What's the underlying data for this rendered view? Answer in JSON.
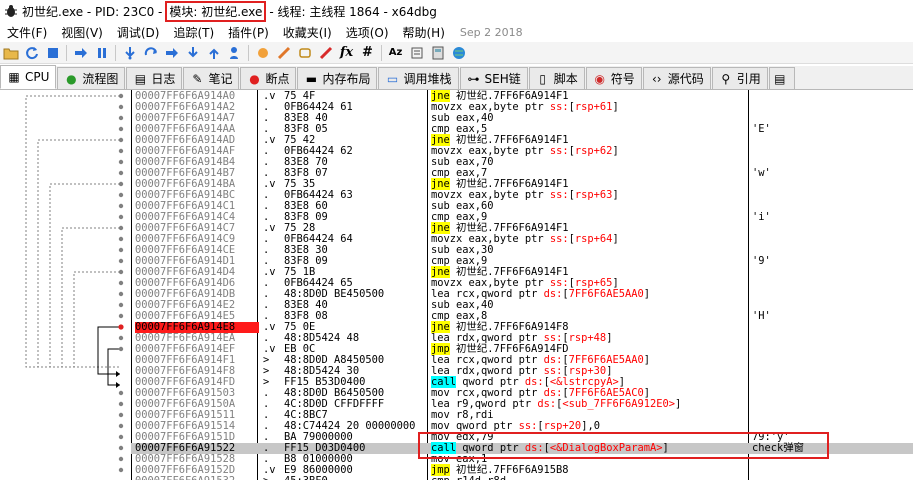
{
  "window": {
    "title_prefix": "初世纪.exe - PID: 23C0 - ",
    "title_module": "模块: 初世纪.exe",
    "title_suffix": " - 线程: 主线程 1864 - x64dbg"
  },
  "menu": {
    "items": [
      "文件(F)",
      "视图(V)",
      "调试(D)",
      "追踪(T)",
      "插件(P)",
      "收藏夹(I)",
      "选项(O)",
      "帮助(H)"
    ],
    "build_date": "Sep 2 2018"
  },
  "toolbar": {
    "icons": [
      "open-icon",
      "restart-icon",
      "stop-icon",
      "run-icon",
      "pause-icon",
      "step-into-icon",
      "step-over-icon",
      "trace-into-icon",
      "trace-over-icon",
      "execute-till-return-icon",
      "run-to-user-code-icon",
      "scylla-icon",
      "comment-icon",
      "label-icon",
      "bookmark-icon",
      "function-icon",
      "hash-icon",
      "font-icon",
      "strings-icon",
      "calculator-icon",
      "globe-icon"
    ],
    "text_glyphs": {
      "function": "fx",
      "hash": "#",
      "font": "Az"
    }
  },
  "tabs": [
    {
      "label": "CPU",
      "icon": "cpu-icon",
      "active": true
    },
    {
      "label": "流程图",
      "icon": "graph-icon"
    },
    {
      "label": "日志",
      "icon": "log-icon"
    },
    {
      "label": "笔记",
      "icon": "notes-icon"
    },
    {
      "label": "断点",
      "icon": "breakpoint-icon"
    },
    {
      "label": "内存布局",
      "icon": "memory-map-icon"
    },
    {
      "label": "调用堆栈",
      "icon": "call-stack-icon"
    },
    {
      "label": "SEH链",
      "icon": "seh-icon"
    },
    {
      "label": "脚本",
      "icon": "script-icon"
    },
    {
      "label": "符号",
      "icon": "symbols-icon"
    },
    {
      "label": "源代码",
      "icon": "source-icon"
    },
    {
      "label": "引用",
      "icon": "references-icon"
    }
  ],
  "disassembly": [
    {
      "addr": "00007FF6F6A914A0",
      "mark": ".v",
      "bytes": "75 4F",
      "asm": [
        [
          "jne",
          "jne"
        ],
        [
          "lbl",
          " 初世纪.7FF6F6A914F1"
        ]
      ],
      "comment": ""
    },
    {
      "addr": "00007FF6F6A914A2",
      "mark": ".",
      "bytes": "0FB64424 61",
      "asm": [
        [
          "kw",
          "movzx eax,byte ptr "
        ],
        [
          "seg",
          "ss:"
        ],
        [
          "brk",
          "["
        ],
        [
          "mem",
          "rsp+61"
        ],
        [
          "brk",
          "]"
        ]
      ],
      "comment": ""
    },
    {
      "addr": "00007FF6F6A914A7",
      "mark": ".",
      "bytes": "83E8 40",
      "asm": [
        [
          "kw",
          "sub eax,40"
        ]
      ],
      "comment": ""
    },
    {
      "addr": "00007FF6F6A914AA",
      "mark": ".",
      "bytes": "83F8 05",
      "asm": [
        [
          "kw",
          "cmp eax,5"
        ]
      ],
      "comment": "'E'"
    },
    {
      "addr": "00007FF6F6A914AD",
      "mark": ".v",
      "bytes": "75 42",
      "asm": [
        [
          "jne",
          "jne"
        ],
        [
          "lbl",
          " 初世纪.7FF6F6A914F1"
        ]
      ],
      "comment": ""
    },
    {
      "addr": "00007FF6F6A914AF",
      "mark": ".",
      "bytes": "0FB64424 62",
      "asm": [
        [
          "kw",
          "movzx eax,byte ptr "
        ],
        [
          "seg",
          "ss:"
        ],
        [
          "brk",
          "["
        ],
        [
          "mem",
          "rsp+62"
        ],
        [
          "brk",
          "]"
        ]
      ],
      "comment": ""
    },
    {
      "addr": "00007FF6F6A914B4",
      "mark": ".",
      "bytes": "83E8 70",
      "asm": [
        [
          "kw",
          "sub eax,70"
        ]
      ],
      "comment": ""
    },
    {
      "addr": "00007FF6F6A914B7",
      "mark": ".",
      "bytes": "83F8 07",
      "asm": [
        [
          "kw",
          "cmp eax,7"
        ]
      ],
      "comment": "'w'"
    },
    {
      "addr": "00007FF6F6A914BA",
      "mark": ".v",
      "bytes": "75 35",
      "asm": [
        [
          "jne",
          "jne"
        ],
        [
          "lbl",
          " 初世纪.7FF6F6A914F1"
        ]
      ],
      "comment": ""
    },
    {
      "addr": "00007FF6F6A914BC",
      "mark": ".",
      "bytes": "0FB64424 63",
      "asm": [
        [
          "kw",
          "movzx eax,byte ptr "
        ],
        [
          "seg",
          "ss:"
        ],
        [
          "brk",
          "["
        ],
        [
          "mem",
          "rsp+63"
        ],
        [
          "brk",
          "]"
        ]
      ],
      "comment": ""
    },
    {
      "addr": "00007FF6F6A914C1",
      "mark": ".",
      "bytes": "83E8 60",
      "asm": [
        [
          "kw",
          "sub eax,60"
        ]
      ],
      "comment": ""
    },
    {
      "addr": "00007FF6F6A914C4",
      "mark": ".",
      "bytes": "83F8 09",
      "asm": [
        [
          "kw",
          "cmp eax,9"
        ]
      ],
      "comment": "'i'"
    },
    {
      "addr": "00007FF6F6A914C7",
      "mark": ".v",
      "bytes": "75 28",
      "asm": [
        [
          "jne",
          "jne"
        ],
        [
          "lbl",
          " 初世纪.7FF6F6A914F1"
        ]
      ],
      "comment": ""
    },
    {
      "addr": "00007FF6F6A914C9",
      "mark": ".",
      "bytes": "0FB64424 64",
      "asm": [
        [
          "kw",
          "movzx eax,byte ptr "
        ],
        [
          "seg",
          "ss:"
        ],
        [
          "brk",
          "["
        ],
        [
          "mem",
          "rsp+64"
        ],
        [
          "brk",
          "]"
        ]
      ],
      "comment": ""
    },
    {
      "addr": "00007FF6F6A914CE",
      "mark": ".",
      "bytes": "83E8 30",
      "asm": [
        [
          "kw",
          "sub eax,30"
        ]
      ],
      "comment": ""
    },
    {
      "addr": "00007FF6F6A914D1",
      "mark": ".",
      "bytes": "83F8 09",
      "asm": [
        [
          "kw",
          "cmp eax,9"
        ]
      ],
      "comment": "'9'"
    },
    {
      "addr": "00007FF6F6A914D4",
      "mark": ".v",
      "bytes": "75 1B",
      "asm": [
        [
          "jne",
          "jne"
        ],
        [
          "lbl",
          " 初世纪.7FF6F6A914F1"
        ]
      ],
      "comment": ""
    },
    {
      "addr": "00007FF6F6A914D6",
      "mark": ".",
      "bytes": "0FB64424 65",
      "asm": [
        [
          "kw",
          "movzx eax,byte ptr "
        ],
        [
          "seg",
          "ss:"
        ],
        [
          "brk",
          "["
        ],
        [
          "mem",
          "rsp+65"
        ],
        [
          "brk",
          "]"
        ]
      ],
      "comment": ""
    },
    {
      "addr": "00007FF6F6A914DB",
      "mark": ".",
      "bytes": "48:8D0D BE450500",
      "asm": [
        [
          "kw",
          "lea rcx,qword ptr "
        ],
        [
          "seg",
          "ds:"
        ],
        [
          "brk",
          "["
        ],
        [
          "mem",
          "7FF6F6AE5AA0"
        ],
        [
          "brk",
          "]"
        ]
      ],
      "comment": ""
    },
    {
      "addr": "00007FF6F6A914E2",
      "mark": ".",
      "bytes": "83E8 40",
      "asm": [
        [
          "kw",
          "sub eax,40"
        ]
      ],
      "comment": ""
    },
    {
      "addr": "00007FF6F6A914E5",
      "mark": ".",
      "bytes": "83F8 08",
      "asm": [
        [
          "kw",
          "cmp eax,8"
        ]
      ],
      "comment": "'H'"
    },
    {
      "addr": "00007FF6F6A914E8",
      "mark": ".v",
      "bytes": "75 0E",
      "asm": [
        [
          "jne",
          "jne"
        ],
        [
          "lbl",
          " 初世纪.7FF6F6A914F8"
        ]
      ],
      "comment": "",
      "bp": true
    },
    {
      "addr": "00007FF6F6A914EA",
      "mark": ".",
      "bytes": "48:8D5424 48",
      "asm": [
        [
          "kw",
          "lea rdx,qword ptr "
        ],
        [
          "seg",
          "ss:"
        ],
        [
          "brk",
          "["
        ],
        [
          "mem",
          "rsp+48"
        ],
        [
          "brk",
          "]"
        ]
      ],
      "comment": ""
    },
    {
      "addr": "00007FF6F6A914EF",
      "mark": ".v",
      "bytes": "EB 0C",
      "asm": [
        [
          "jmp",
          "jmp"
        ],
        [
          "lbl",
          " 初世纪.7FF6F6A914FD"
        ]
      ],
      "comment": ""
    },
    {
      "addr": "00007FF6F6A914F1",
      "mark": ">",
      "bytes": "48:8D0D A8450500",
      "asm": [
        [
          "kw",
          "lea rcx,qword ptr "
        ],
        [
          "seg",
          "ds:"
        ],
        [
          "brk",
          "["
        ],
        [
          "mem",
          "7FF6F6AE5AA0"
        ],
        [
          "brk",
          "]"
        ]
      ],
      "comment": ""
    },
    {
      "addr": "00007FF6F6A914F8",
      "mark": ">",
      "bytes": "48:8D5424 30",
      "asm": [
        [
          "kw",
          "lea rdx,qword ptr "
        ],
        [
          "seg",
          "ss:"
        ],
        [
          "brk",
          "["
        ],
        [
          "mem",
          "rsp+30"
        ],
        [
          "brk",
          "]"
        ]
      ],
      "comment": ""
    },
    {
      "addr": "00007FF6F6A914FD",
      "mark": ">",
      "bytes": "FF15 B53D0400",
      "asm": [
        [
          "call",
          "call"
        ],
        [
          "kw",
          " qword ptr "
        ],
        [
          "seg",
          "ds:"
        ],
        [
          "brk",
          "["
        ],
        [
          "mem",
          "<&lstrcpyA>"
        ],
        [
          "brk",
          "]"
        ]
      ],
      "comment": ""
    },
    {
      "addr": "00007FF6F6A91503",
      "mark": ".",
      "bytes": "48:8D0D B6450500",
      "asm": [
        [
          "kw",
          "mov rcx,qword ptr "
        ],
        [
          "seg",
          "ds:"
        ],
        [
          "brk",
          "["
        ],
        [
          "mem",
          "7FF6F6AE5AC0"
        ],
        [
          "brk",
          "]"
        ]
      ],
      "comment": ""
    },
    {
      "addr": "00007FF6F6A9150A",
      "mark": ".",
      "bytes": "4C:8D0D CFFDFFFF",
      "asm": [
        [
          "kw",
          "lea r9,qword ptr "
        ],
        [
          "seg",
          "ds:"
        ],
        [
          "brk",
          "["
        ],
        [
          "mem",
          "<sub_7FF6F6A912E0>"
        ],
        [
          "brk",
          "]"
        ]
      ],
      "comment": ""
    },
    {
      "addr": "00007FF6F6A91511",
      "mark": ".",
      "bytes": "4C:8BC7",
      "asm": [
        [
          "kw",
          "mov r8,rdi"
        ]
      ],
      "comment": ""
    },
    {
      "addr": "00007FF6F6A91514",
      "mark": ".",
      "bytes": "48:C74424 20 00000000",
      "asm": [
        [
          "kw",
          "mov qword ptr "
        ],
        [
          "seg",
          "ss:"
        ],
        [
          "brk",
          "["
        ],
        [
          "mem",
          "rsp+20"
        ],
        [
          "brk",
          "],0"
        ]
      ],
      "comment": ""
    },
    {
      "addr": "00007FF6F6A9151D",
      "mark": ".",
      "bytes": "BA 79000000",
      "asm": [
        [
          "kw",
          "mov edx,79"
        ]
      ],
      "comment": "79:'y'"
    },
    {
      "addr": "00007FF6F6A91522",
      "mark": ".",
      "bytes": "FF15 D03D0400",
      "asm": [
        [
          "call",
          "call"
        ],
        [
          "kw",
          " qword ptr "
        ],
        [
          "seg",
          "ds:"
        ],
        [
          "brk",
          "["
        ],
        [
          "mem",
          "<&DialogBoxParamA>"
        ],
        [
          "brk",
          "]"
        ]
      ],
      "comment": "check弹窗",
      "current": true
    },
    {
      "addr": "00007FF6F6A91528",
      "mark": ".",
      "bytes": "B8 01000000",
      "asm": [
        [
          "kw",
          "mov eax,1"
        ]
      ],
      "comment": ""
    },
    {
      "addr": "00007FF6F6A9152D",
      "mark": ".v",
      "bytes": "E9 86000000",
      "asm": [
        [
          "jmp",
          "jmp"
        ],
        [
          "lbl",
          " 初世纪.7FF6F6A915B8"
        ]
      ],
      "comment": ""
    },
    {
      "addr": "00007FF6F6A91532",
      "mark": ">",
      "bytes": "45:3BF0",
      "asm": [
        [
          "kw",
          "cmp r14d,r8d"
        ]
      ],
      "comment": ""
    }
  ],
  "colors": {
    "jump_highlight": "#ffff00",
    "call_highlight": "#00ffff",
    "breakpoint": "#ff1a1a",
    "annotation_box": "#e02020",
    "current_line": "#c7c7c7"
  }
}
